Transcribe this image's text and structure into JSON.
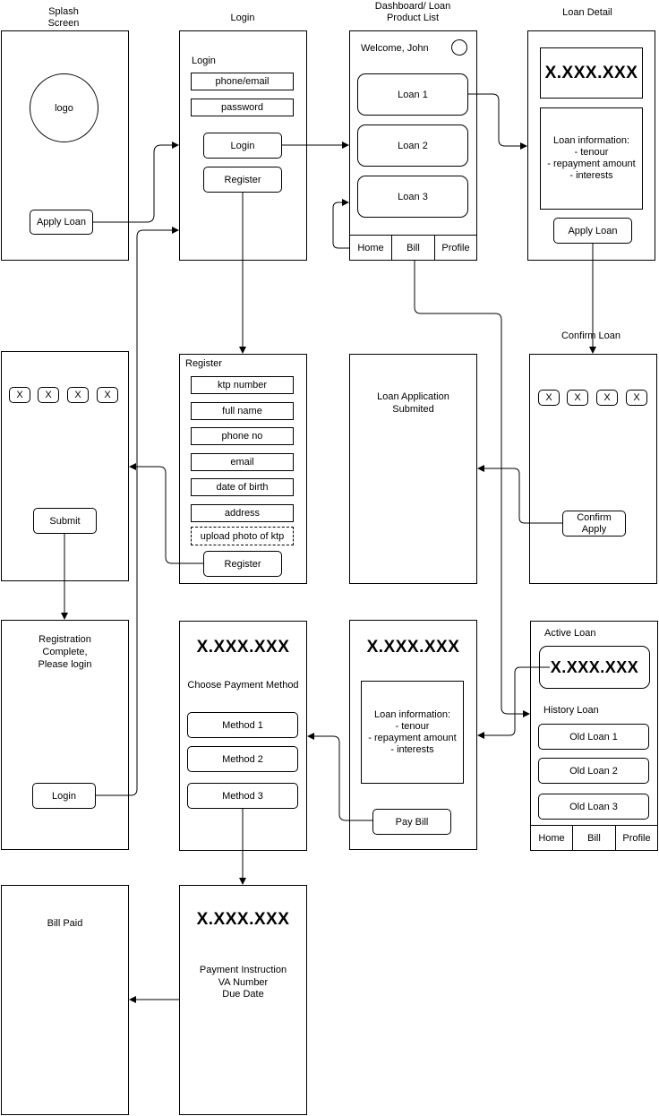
{
  "titles": {
    "splash": "Splash\nScreen",
    "login": "Login",
    "dashboard": "Dashboard/ Loan\nProduct List",
    "loan_detail": "Loan Detail",
    "confirm_loan": "Confirm Loan"
  },
  "splash": {
    "logo": "logo",
    "apply_loan": "Apply Loan"
  },
  "login": {
    "heading": "Login",
    "phone_email": "phone/email",
    "password": "password",
    "login_button": "Login",
    "register_button": "Register"
  },
  "dashboard": {
    "welcome": "Welcome, John",
    "loans": [
      "Loan 1",
      "Loan 2",
      "Loan 3"
    ],
    "nav": [
      "Home",
      "Bill",
      "Profile"
    ]
  },
  "loan_detail": {
    "amount": "X.XXX.XXX",
    "info": "Loan information:\n- tenour\n- repayment amount\n- interests",
    "apply_button": "Apply Loan"
  },
  "otp_register": {
    "digits": [
      "X",
      "X",
      "X",
      "X"
    ],
    "submit": "Submit"
  },
  "register": {
    "heading": "Register",
    "fields": [
      "ktp number",
      "full name",
      "phone no",
      "email",
      "date of birth",
      "address"
    ],
    "upload": "upload photo of ktp",
    "register_button": "Register"
  },
  "submitted": {
    "text": "Loan Application\nSubmited"
  },
  "confirm": {
    "digits": [
      "X",
      "X",
      "X",
      "X"
    ],
    "confirm_button": "Confirm\nApply"
  },
  "reg_complete": {
    "text": "Registration\nComplete,\nPlease login",
    "login_button": "Login"
  },
  "payment": {
    "amount": "X.XXX.XXX",
    "heading": "Choose Payment Method",
    "methods": [
      "Method 1",
      "Method 2",
      "Method 3"
    ]
  },
  "bill_detail": {
    "amount": "X.XXX.XXX",
    "info": "Loan information:\n- tenour\n- repayment amount\n- interests",
    "pay_button": "Pay Bill"
  },
  "active_loan": {
    "heading": "Active Loan",
    "amount": "X.XXX.XXX",
    "history_heading": "History Loan",
    "history": [
      "Old Loan 1",
      "Old Loan 2",
      "Old Loan 3"
    ],
    "nav": [
      "Home",
      "Bill",
      "Profile"
    ]
  },
  "bill_paid": {
    "text": "Bill Paid"
  },
  "instruction": {
    "amount": "X.XXX.XXX",
    "text": "Payment Instruction\nVA Number\nDue Date"
  }
}
